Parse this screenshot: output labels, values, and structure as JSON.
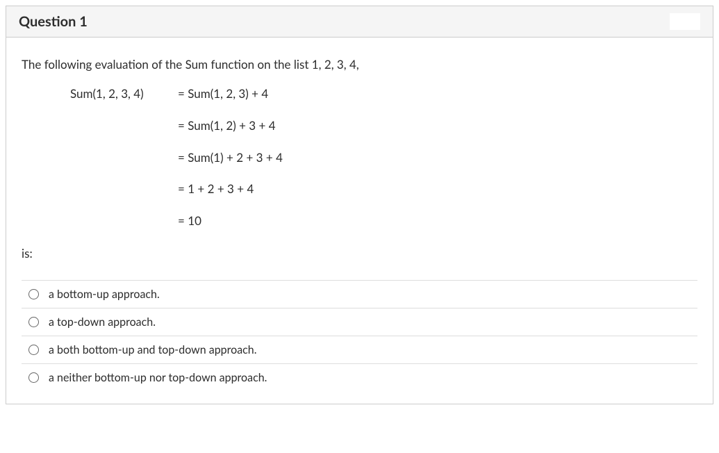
{
  "question": {
    "title": "Question 1",
    "intro": "The following evaluation of the Sum function on the list 1, 2, 3, 4,",
    "equations": {
      "left": "Sum(1, 2, 3, 4)",
      "steps": [
        "= Sum(1, 2, 3) + 4",
        "= Sum(1, 2) + 3 + 4",
        "= Sum(1) + 2 + 3 + 4",
        "= 1 + 2 + 3 + 4",
        "= 10"
      ]
    },
    "trailing": "is:",
    "options": [
      "a bottom-up approach.",
      "a top-down approach.",
      "a both bottom-up and top-down approach.",
      "a neither bottom-up nor top-down approach."
    ]
  }
}
